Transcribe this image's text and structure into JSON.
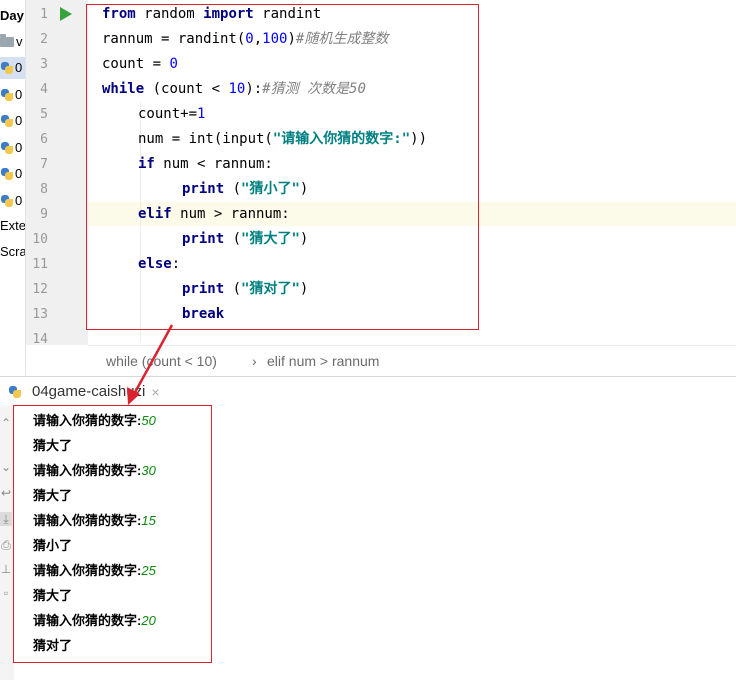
{
  "project_panel": {
    "items": [
      {
        "icon": "folder-icon",
        "label": "Day"
      },
      {
        "icon": "folder-icon",
        "label": "v"
      },
      {
        "icon": "python-file-icon",
        "label": "0"
      },
      {
        "icon": "python-file-icon",
        "label": "0"
      },
      {
        "icon": "python-file-icon",
        "label": "0"
      },
      {
        "icon": "python-file-icon",
        "label": "0"
      },
      {
        "icon": "python-file-icon",
        "label": "0"
      },
      {
        "icon": "python-file-icon",
        "label": "0"
      },
      {
        "icon": "external-libraries-icon",
        "label": "Exte"
      },
      {
        "icon": "scratches-icon",
        "label": "Scra"
      }
    ]
  },
  "editor": {
    "line_numbers": [
      "1",
      "2",
      "3",
      "4",
      "5",
      "6",
      "7",
      "8",
      "9",
      "10",
      "11",
      "12",
      "13",
      "14"
    ],
    "current_line": "9",
    "code": {
      "l1": {
        "kw1": "from",
        "t1": " random ",
        "kw2": "import",
        "t2": " randint"
      },
      "l2": {
        "t1": "rannum = randint(",
        "n1": "0",
        "t2": ",",
        "n2": "100",
        "t3": ")",
        "cmt": "#随机生成整数"
      },
      "l3": {
        "t1": "count = ",
        "n1": "0"
      },
      "l4": {
        "kw1": "while",
        "t1": " (count < ",
        "n1": "10",
        "t2": "):",
        "cmt": "#猜测 次数是50"
      },
      "l5": {
        "t1": "count+=",
        "n1": "1"
      },
      "l6": {
        "t1": "num = int(input(",
        "s1": "\"请输入你猜的数字:\"",
        "t2": "))"
      },
      "l7": {
        "kw1": "if",
        "t1": " num < rannum:"
      },
      "l8": {
        "kw1": "print",
        "t1": " (",
        "s1": "\"猜小了\"",
        "t2": ")"
      },
      "l9": {
        "kw1": "elif",
        "t1": " num > rannum:"
      },
      "l10": {
        "kw1": "print",
        "t1": " (",
        "s1": "\"猜大了\"",
        "t2": ")"
      },
      "l11": {
        "kw1": "else",
        "t1": ":"
      },
      "l12": {
        "kw1": "print",
        "t1": " (",
        "s1": "\"猜对了\"",
        "t2": ")"
      },
      "l13": {
        "kw1": "break"
      }
    }
  },
  "breadcrumb": {
    "item1": "while (count < 10)",
    "separator": "›",
    "item2": "elif num > rannum"
  },
  "run_panel": {
    "tab_label": "04game-caishuzi",
    "close_glyph": "×"
  },
  "console": {
    "lines": [
      {
        "prompt": "请输入你猜的数字:",
        "input": "50"
      },
      {
        "text": "猜大了"
      },
      {
        "prompt": "请输入你猜的数字:",
        "input": "30"
      },
      {
        "text": "猜大了"
      },
      {
        "prompt": "请输入你猜的数字:",
        "input": "15"
      },
      {
        "text": "猜小了"
      },
      {
        "prompt": "请输入你猜的数字:",
        "input": "25"
      },
      {
        "text": "猜大了"
      },
      {
        "prompt": "请输入你猜的数字:",
        "input": "20"
      },
      {
        "text": "猜对了"
      }
    ]
  },
  "colors": {
    "annotation_red": "#d9232e",
    "keyword": "#000080",
    "number": "#0000ff",
    "string": "#008080",
    "comment": "#808080",
    "input_echo": "#0a8a0a",
    "run_icon": "#3aa23a"
  }
}
